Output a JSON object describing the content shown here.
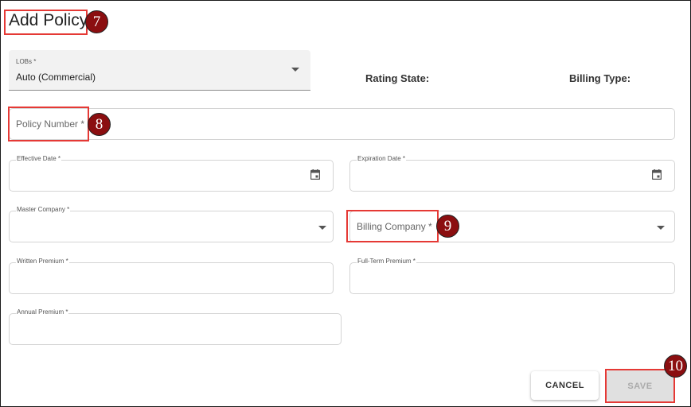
{
  "dialog": {
    "title": "Add Policy"
  },
  "badges": {
    "b7": "7",
    "b8": "8",
    "b9": "9",
    "b10": "10"
  },
  "lob": {
    "label": "LOBs *",
    "value": "Auto (Commercial)"
  },
  "info": {
    "rating_state_label": "Rating State:",
    "billing_type_label": "Billing Type:"
  },
  "fields": {
    "policy_number": "Policy Number *",
    "effective_date": "Effective Date *",
    "expiration_date": "Expiration Date *",
    "master_company": "Master Company *",
    "billing_company": "Billing Company *",
    "written_premium": "Written Premium *",
    "full_term_premium": "Full-Term Premium *",
    "annual_premium": "Annual Premium *"
  },
  "buttons": {
    "cancel": "CANCEL",
    "save": "SAVE"
  },
  "colors": {
    "highlight": "#e53935",
    "badge": "#8b0e10",
    "disabled_button": "#e0e0e0"
  },
  "icons": {
    "date_picker": "calendar-icon",
    "dropdown": "chevron-down-icon"
  }
}
